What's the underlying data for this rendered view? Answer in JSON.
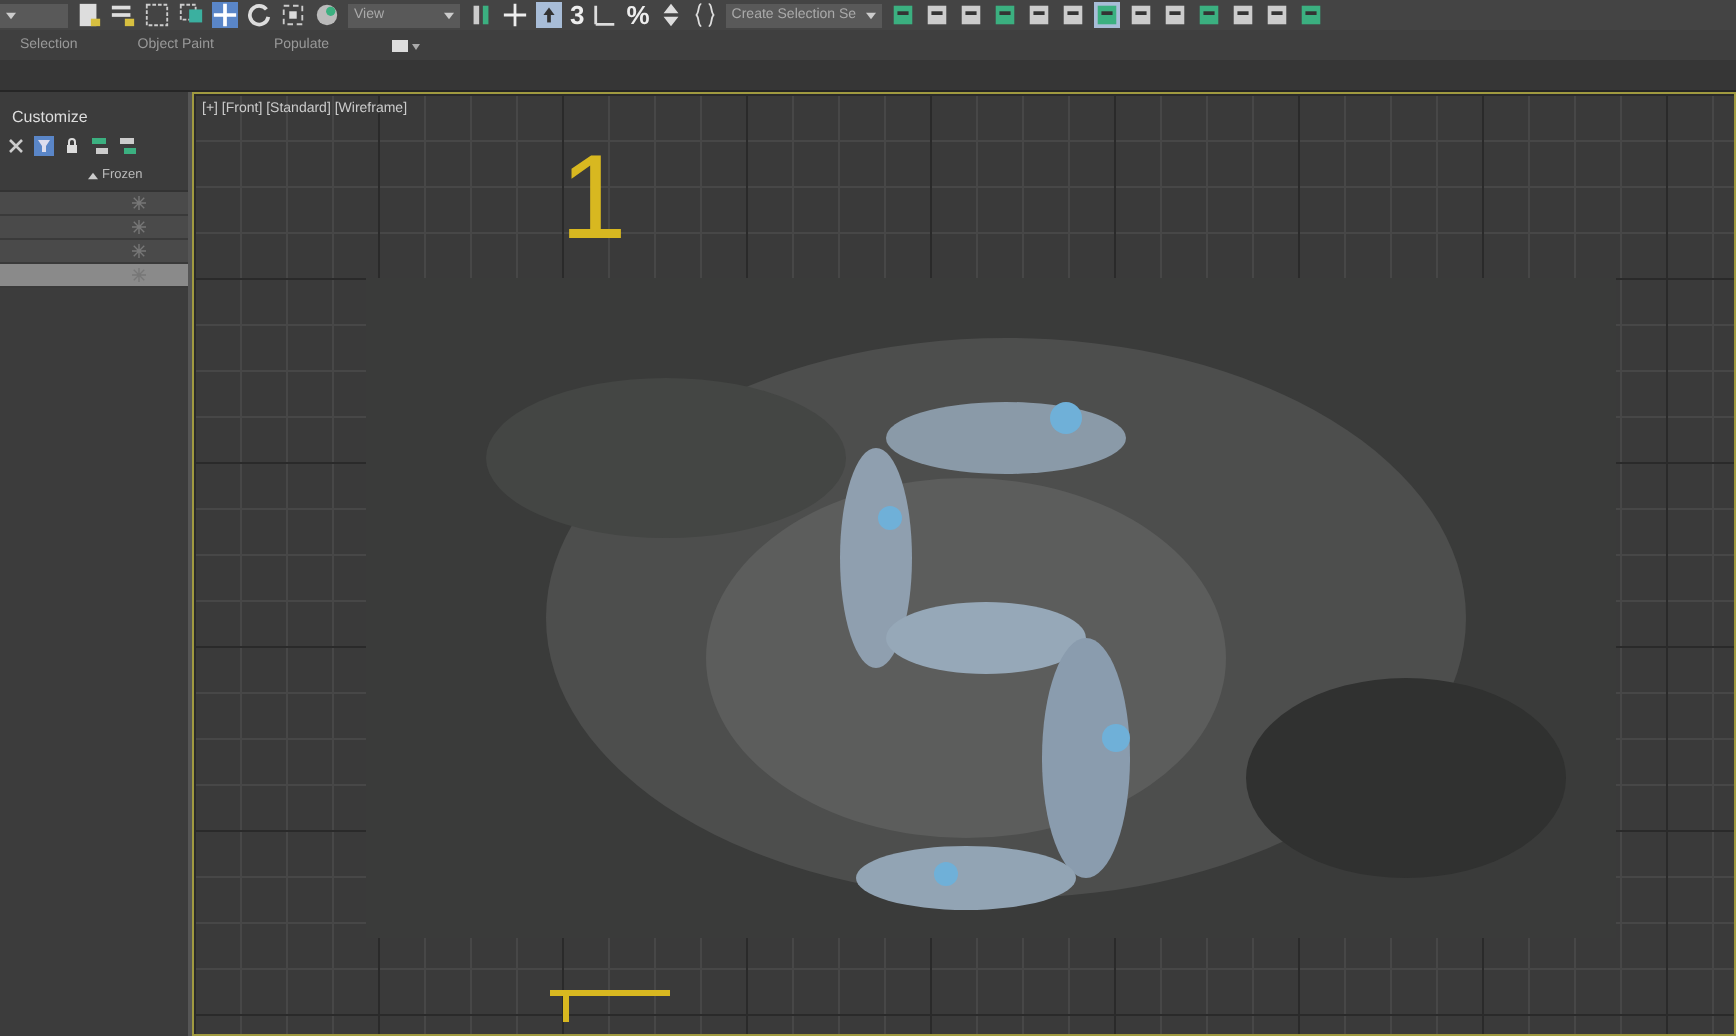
{
  "toolbar": {
    "snap_label": "3",
    "percent_label": "%",
    "view_dropdown": "View",
    "selection_set_dropdown": "Create Selection Se"
  },
  "ribbon_tabs": [
    {
      "label": "Selection"
    },
    {
      "label": "Object Paint"
    },
    {
      "label": "Populate"
    }
  ],
  "scene_explorer": {
    "title": "Customize",
    "filter_on": true,
    "column": "Frozen",
    "rows": [
      {
        "selected": false
      },
      {
        "selected": false
      },
      {
        "selected": false
      },
      {
        "selected": true
      }
    ]
  },
  "viewport": {
    "label": "[+] [Front] [Standard] [Wireframe]",
    "spline_text": "1"
  }
}
